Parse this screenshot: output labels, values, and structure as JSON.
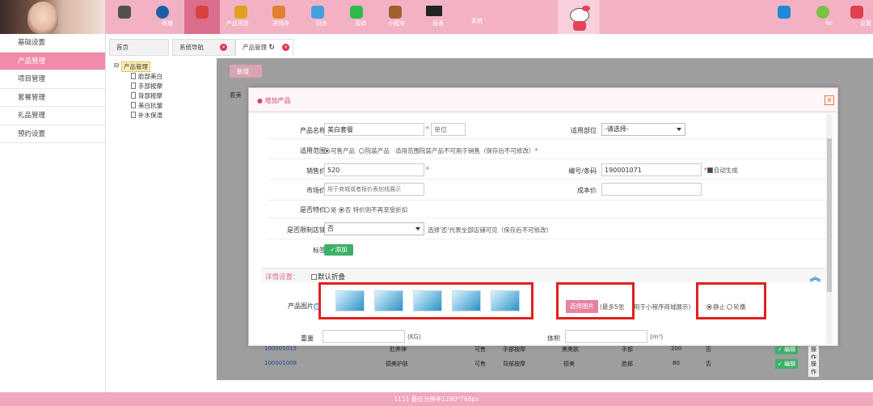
{
  "topnav": {
    "items": [
      {
        "label": "收银",
        "icon": "cash-register-icon",
        "color": "#505050"
      },
      {
        "label": "会员",
        "icon": "member-icon",
        "color": "#1a5fa8"
      },
      {
        "label": "产品项目",
        "icon": "product-icon",
        "color": "#d94040"
      },
      {
        "label": "进销存",
        "icon": "inventory-icon",
        "color": "#e0a020"
      },
      {
        "label": "财务",
        "icon": "finance-icon",
        "color": "#e08030"
      },
      {
        "label": "营销",
        "icon": "marketing-icon",
        "color": "#40a0e0"
      },
      {
        "label": "小程序",
        "icon": "wechat-icon",
        "color": "#2dbb4a"
      },
      {
        "label": "报表",
        "icon": "report-icon",
        "color": "#a06030"
      },
      {
        "label": "系统",
        "icon": "monitor-icon",
        "color": "#222222"
      }
    ],
    "right": [
      {
        "label": "fin",
        "icon": "user-icon",
        "color": "#1e88d8"
      },
      {
        "label": "设置",
        "icon": "settings-icon",
        "color": "#7cc040"
      },
      {
        "label": "退出",
        "icon": "logout-icon",
        "color": "#e04050"
      }
    ]
  },
  "sidebar": {
    "items": [
      {
        "label": "基础设置"
      },
      {
        "label": "产品管理"
      },
      {
        "label": "项目管理"
      },
      {
        "label": "套餐管理"
      },
      {
        "label": "礼品管理"
      },
      {
        "label": "预约设置"
      }
    ]
  },
  "tabs": [
    {
      "label": "首页"
    },
    {
      "label": "系统导航"
    },
    {
      "label": "产品管理"
    }
  ],
  "tree": {
    "root": "产品管理",
    "children": [
      "脸部美白",
      "手部按摩",
      "背部按摩",
      "美白抗皱",
      "补水保湿"
    ]
  },
  "background": {
    "add_button": "新增",
    "search_prefix": "套美",
    "rows": [
      {
        "code": "100001015",
        "name": "肛养神",
        "status": "可售",
        "cat": "手部按摩",
        "type": "美美肤",
        "part": "手部",
        "price": "200",
        "special": "否",
        "op": "操作"
      },
      {
        "code": "100001008",
        "name": "德美护肤",
        "status": "可售",
        "cat": "背部按摩",
        "type": "德美",
        "part": "脸部",
        "price": "80",
        "special": "否",
        "op": "操作"
      }
    ],
    "action_edit": "✓ 编辑"
  },
  "modal": {
    "title": "● 增加产品",
    "close": "×",
    "fields": {
      "name_label": "产品名称",
      "name_value": "美白套餐",
      "unit_placeholder": "单位",
      "part_label": "适用部位",
      "part_value": "-请选择-",
      "scope_label": "适用范围",
      "scope_opt1": "可售产品",
      "scope_opt2": "院装产品",
      "scope_hint": "适用范围院装产品不可用于销售（保存后不可修改）",
      "price_label": "销售价",
      "price_value": "520",
      "code_label": "编号/条码",
      "code_value": "190001071",
      "auto_gen": "自动生成",
      "market_label": "市场价",
      "market_placeholder": "用于商城或者报价表划线展示",
      "cost_label": "成本价",
      "special_label": "是否特价",
      "special_yes": "是",
      "special_no": "否",
      "special_hint": "特价则不再享受折扣",
      "limit_label": "是否限制店铺",
      "limit_value": "否",
      "limit_hint": "选择'否'代表全部店铺可见（保存后不可修改）",
      "tag_label": "标签",
      "tag_button": "✓添加",
      "detail_title": "详情设置：",
      "detail_default": "默认折叠",
      "image_label": "产品图片",
      "choose_button": "选择图片",
      "max_hint": "(最多5张",
      "mini_hint": "用于小程序商城展示)",
      "static": "静止",
      "carousel": "轮播",
      "weight_label": "重量",
      "weight_unit": "(KG)",
      "volume_label": "体积",
      "volume_unit": "(m³)"
    }
  },
  "footer": {
    "text": "1111   最佳分辨率1280*768px"
  }
}
